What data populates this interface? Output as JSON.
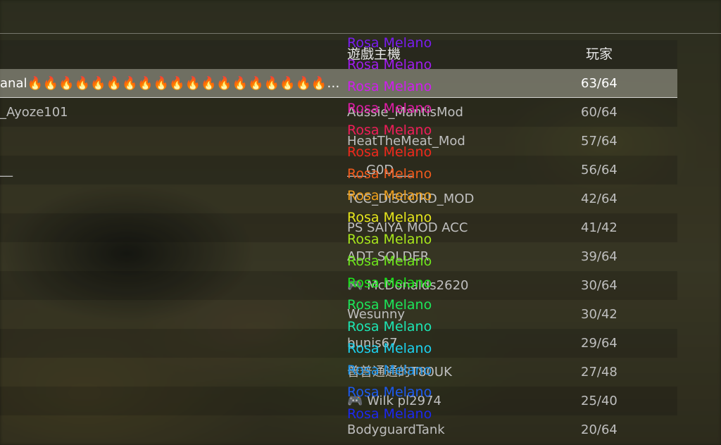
{
  "columns": {
    "host": "遊戲主機",
    "players": "玩家"
  },
  "rows": [
    {
      "name": "anal🔥🔥🔥🔥🔥🔥🔥🔥🔥🔥🔥🔥🔥🔥🔥🔥🔥🔥🔥🔥…",
      "host": "",
      "players": "63/64"
    },
    {
      "name": "_Ayoze101",
      "host": "Aussie_MantisMod",
      "players": "60/64"
    },
    {
      "name": "",
      "host": "HeatTheMeat_Mod",
      "players": "57/64"
    },
    {
      "name": "__",
      "host": "___G0D___",
      "players": "56/64"
    },
    {
      "name": "",
      "host": "TCC_DISCORD_MOD",
      "players": "42/64"
    },
    {
      "name": "",
      "host": "PS SAIYA MOD ACC",
      "players": "41/42"
    },
    {
      "name": "",
      "host": "ADT SOLDER",
      "players": "39/64"
    },
    {
      "name": "",
      "host": "🎮 McDonalds2620",
      "players": "30/64"
    },
    {
      "name": "",
      "host": "Wesunny",
      "players": "30/42"
    },
    {
      "name": "",
      "host": "bunis67",
      "players": "29/64"
    },
    {
      "name": "",
      "host": "普普通通的T80UK",
      "players": "27/48"
    },
    {
      "name": "",
      "host": "🎮 Wilk pl2974",
      "players": "25/40"
    },
    {
      "name": "",
      "host": "BodyguardTank",
      "players": "20/64"
    }
  ],
  "overlay_text": "Rosa Melano",
  "overlay_colors": [
    "#7a1cf0",
    "#a01cf0",
    "#d01cf0",
    "#e01ca8",
    "#f01c5a",
    "#f0281c",
    "#f05a1c",
    "#f0a01c",
    "#e6e61c",
    "#a8e61c",
    "#6ee61c",
    "#1ce61c",
    "#1ce65a",
    "#1ce6b4",
    "#1cd2f0",
    "#1c96f0",
    "#1c5af0",
    "#1c28f0"
  ]
}
